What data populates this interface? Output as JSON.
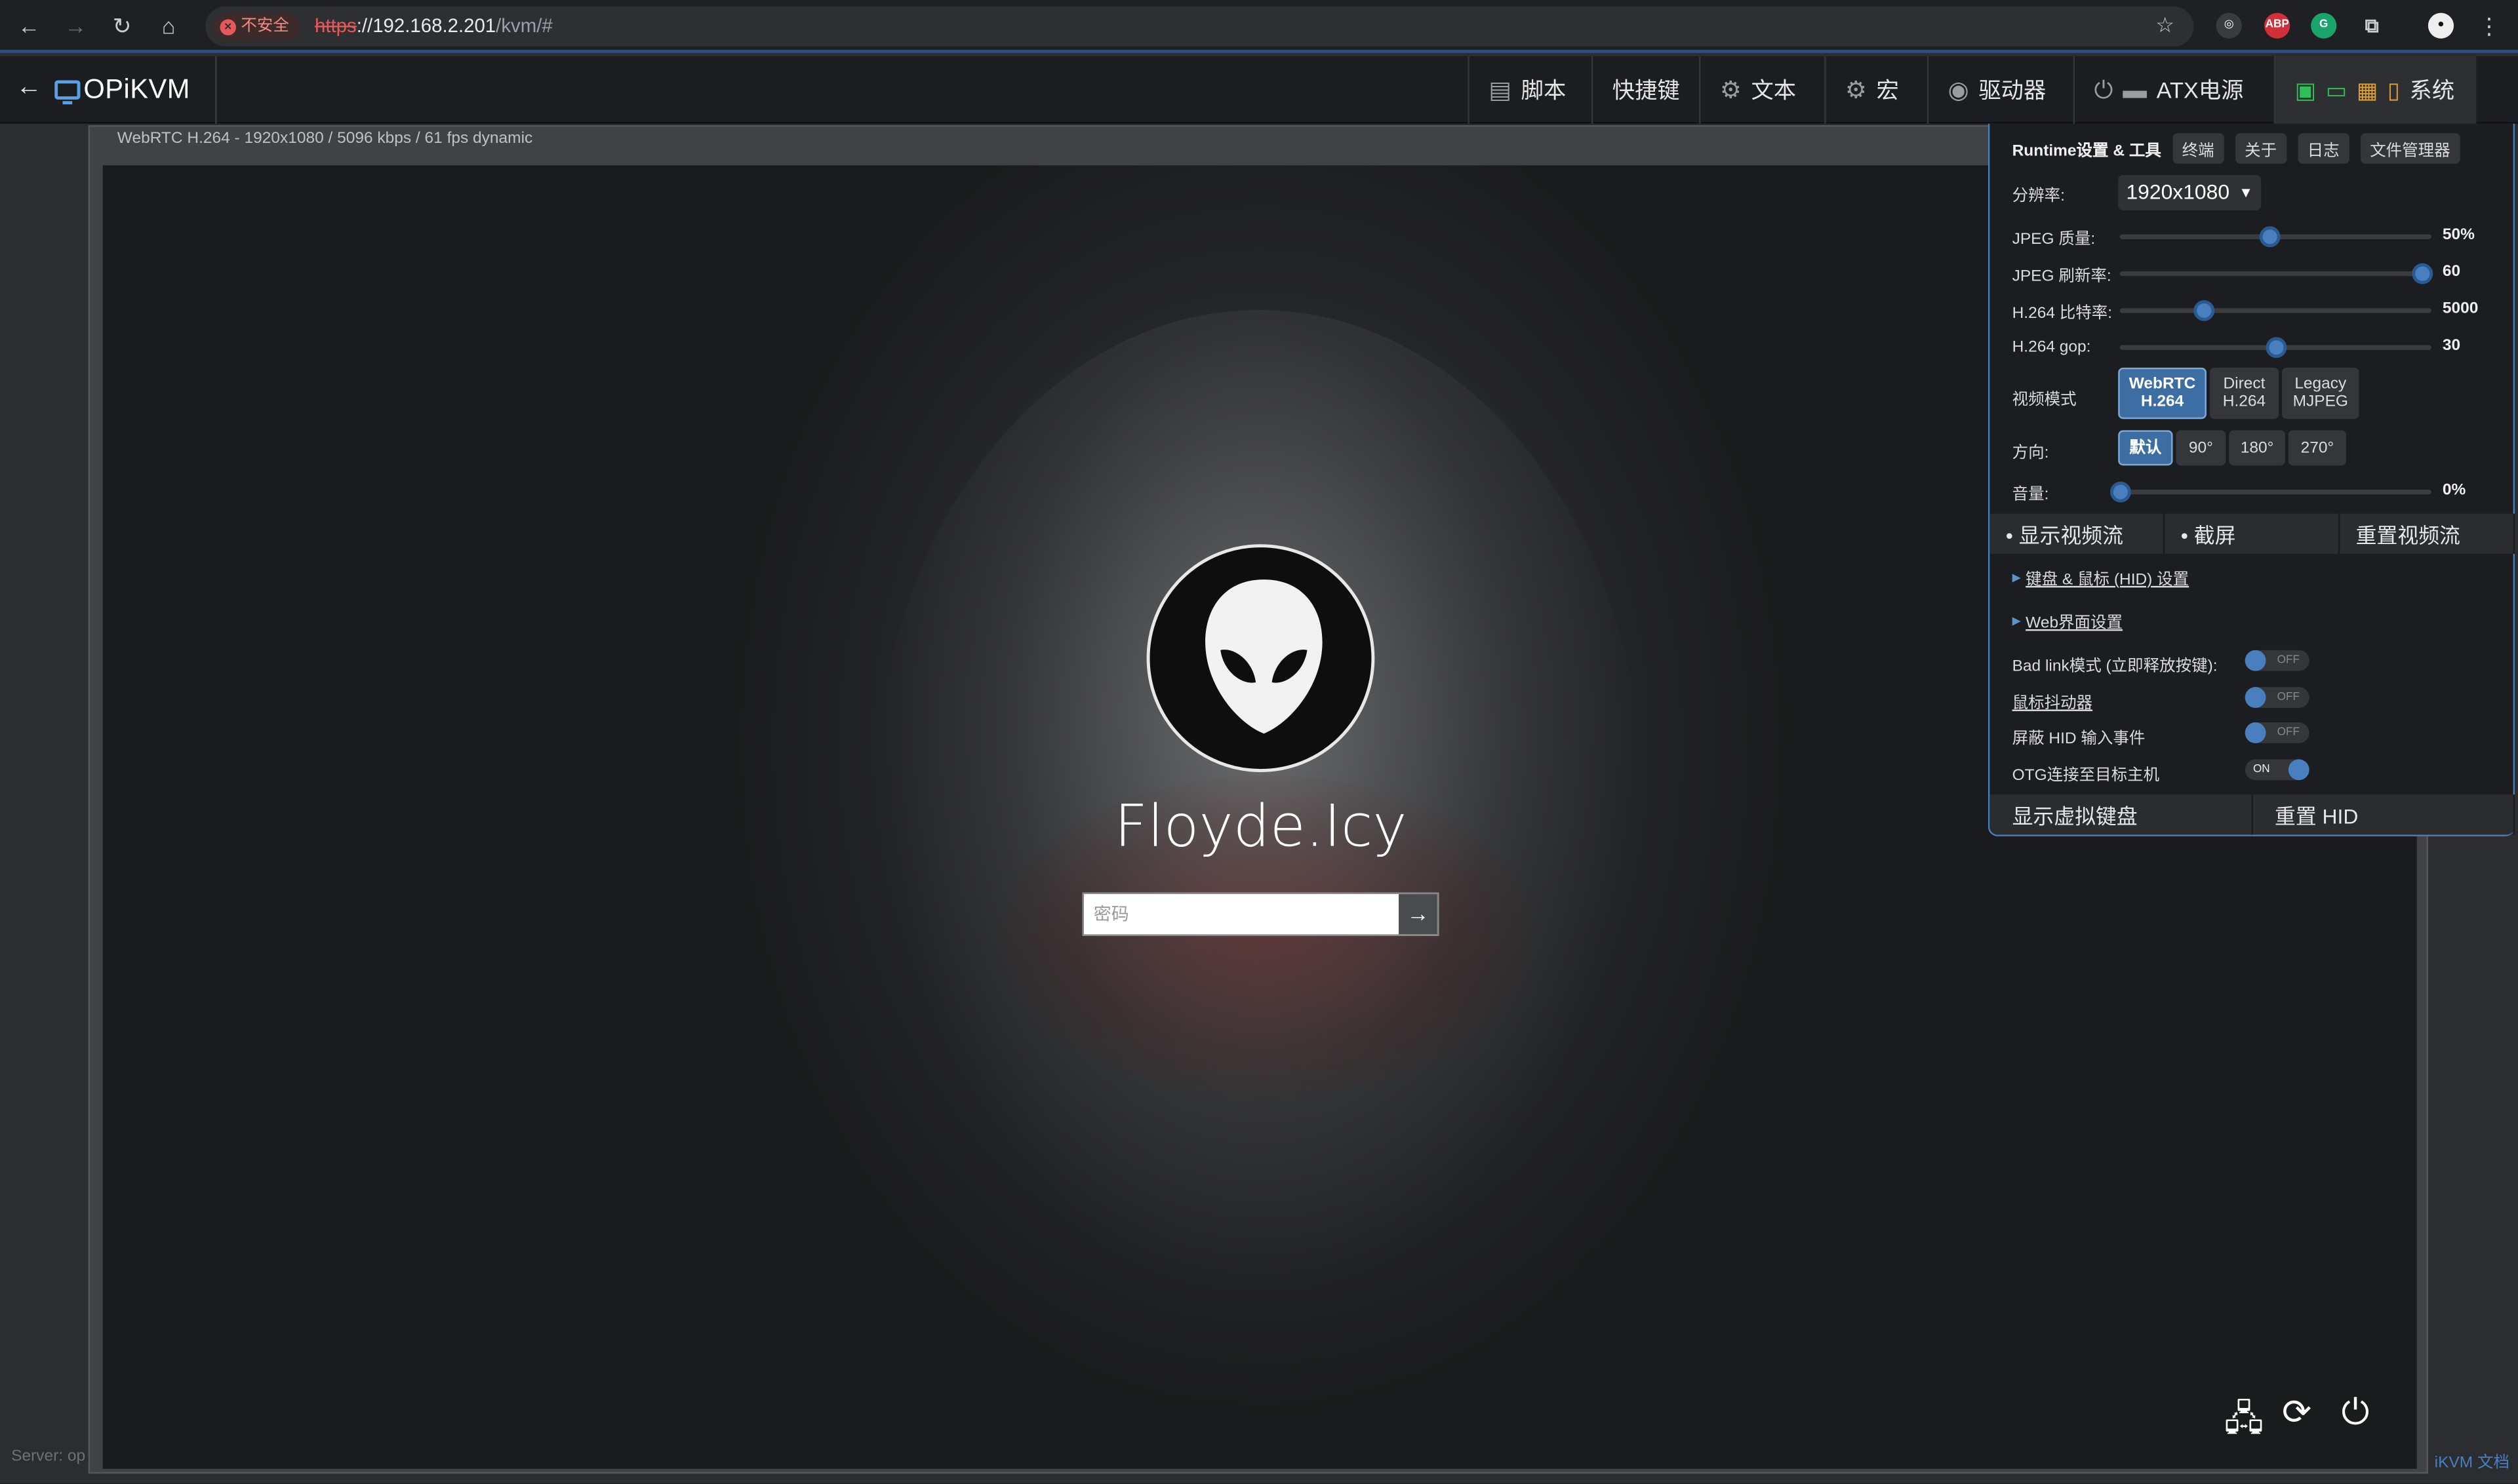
{
  "browser": {
    "security_label": "不安全",
    "url_scheme": "https",
    "url_host": "://192.168.2.201",
    "url_path": "/kvm/#",
    "extension_abp": "ABP"
  },
  "navbar": {
    "logo": "OPiKVM",
    "items": [
      "脚本",
      "快捷键",
      "文本",
      "宏",
      "驱动器",
      "ATX电源",
      "系统"
    ]
  },
  "stream": {
    "status": "WebRTC H.264 - 1920x1080 / 5096 kbps / 61 fps dynamic",
    "username": "Floyde.Icy",
    "password_placeholder": "密码"
  },
  "footer": {
    "server": "Server: op",
    "docs": "iKVM 文档"
  },
  "panel": {
    "title": "Runtime设置 & 工具",
    "tabs": [
      "终端",
      "关于",
      "日志",
      "文件管理器"
    ],
    "resolution_label": "分辨率:",
    "resolution_value": "1920x1080",
    "sliders": [
      {
        "label": "JPEG 质量:",
        "value": "50%",
        "level": 0.48
      },
      {
        "label": "JPEG 刷新率:",
        "value": "60",
        "level": 0.97
      },
      {
        "label": "H.264 比特率:",
        "value": "5000",
        "level": 0.27
      },
      {
        "label": "H.264 gop:",
        "value": "30",
        "level": 0.5
      }
    ],
    "video_mode_label": "视频模式",
    "video_modes": [
      {
        "l1": "WebRTC",
        "l2": "H.264",
        "active": true
      },
      {
        "l1": "Direct",
        "l2": "H.264",
        "active": false
      },
      {
        "l1": "Legacy",
        "l2": "MJPEG",
        "active": false
      }
    ],
    "orientation_label": "方向:",
    "orientations": [
      {
        "label": "默认",
        "active": true
      },
      {
        "label": "90°",
        "active": false
      },
      {
        "label": "180°",
        "active": false
      },
      {
        "label": "270°",
        "active": false
      }
    ],
    "volume": {
      "label": "音量:",
      "value": "0%",
      "level": 0.0
    },
    "actions": [
      "• 显示视频流",
      "• 截屏",
      "重置视频流"
    ],
    "links": [
      "键盘 & 鼠标 (HID) 设置",
      "Web界面设置"
    ],
    "toggles": [
      {
        "label": "Bad link模式 (立即释放按键):",
        "state": "OFF"
      },
      {
        "label": "鼠标抖动器",
        "state": "OFF"
      },
      {
        "label": "屏蔽 HID 输入事件",
        "state": "OFF"
      },
      {
        "label": "OTG连接至目标主机",
        "state": "ON"
      }
    ],
    "bottom_actions": [
      "显示虚拟键盘",
      "重置 HID"
    ]
  },
  "colors": {
    "accent": "#4a7fbf",
    "insecure": "#e8585a"
  }
}
